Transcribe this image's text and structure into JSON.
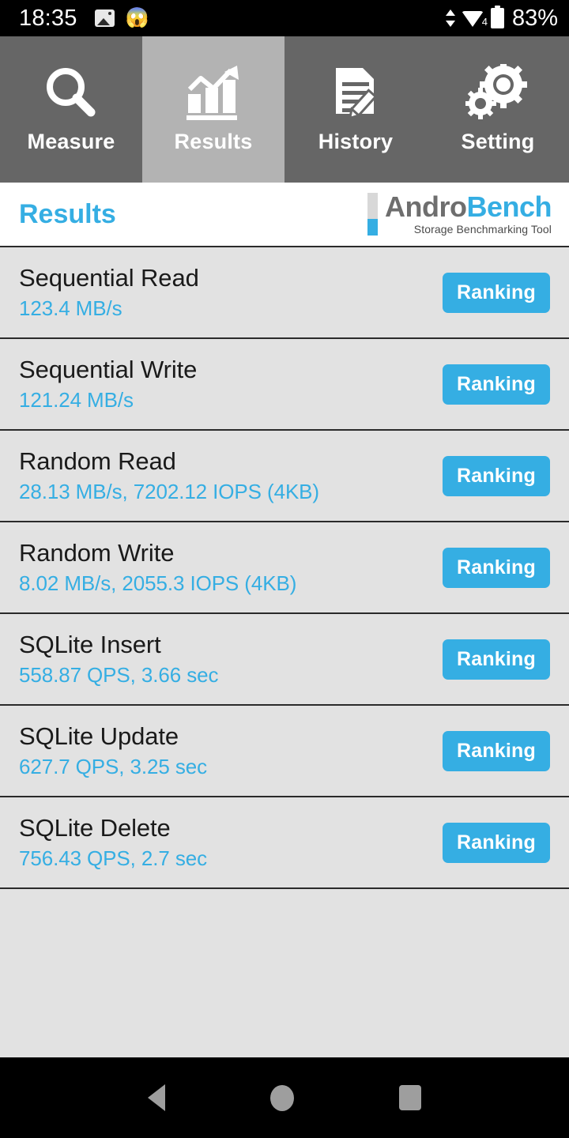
{
  "statusbar": {
    "time": "18:35",
    "photo_icon": "photo-icon",
    "emoji_icon": "😱",
    "updown_icon": "data-transfer-icon",
    "wifi_icon": "wifi-icon",
    "wifi_badge": "4",
    "battery_icon": "battery-icon",
    "battery_percent": "83%"
  },
  "tabs": [
    {
      "label": "Measure",
      "icon": "magnifier-icon",
      "selected": false
    },
    {
      "label": "Results",
      "icon": "bar-chart-icon",
      "selected": true
    },
    {
      "label": "History",
      "icon": "document-pencil-icon",
      "selected": false
    },
    {
      "label": "Setting",
      "icon": "gears-icon",
      "selected": false
    }
  ],
  "header": {
    "title": "Results",
    "logo_primary": "Andro",
    "logo_secondary": "Bench",
    "logo_subtitle": "Storage Benchmarking Tool"
  },
  "results": {
    "button_label": "Ranking",
    "rows": [
      {
        "name": "Sequential Read",
        "value": "123.4 MB/s"
      },
      {
        "name": "Sequential Write",
        "value": "121.24 MB/s"
      },
      {
        "name": "Random Read",
        "value": "28.13 MB/s, 7202.12 IOPS (4KB)"
      },
      {
        "name": "Random Write",
        "value": "8.02 MB/s, 2055.3 IOPS (4KB)"
      },
      {
        "name": "SQLite Insert",
        "value": "558.87 QPS, 3.66 sec"
      },
      {
        "name": "SQLite Update",
        "value": "627.7 QPS, 3.25 sec"
      },
      {
        "name": "SQLite Delete",
        "value": "756.43 QPS, 2.7 sec"
      }
    ]
  },
  "navbar": {
    "back": "back-icon",
    "home": "home-icon",
    "recents": "recents-icon"
  },
  "colors": {
    "accent_blue": "#35AEE3",
    "tab_unselected": "#666666",
    "tab_selected": "#B3B3B3",
    "list_background": "#E2E2E2"
  }
}
